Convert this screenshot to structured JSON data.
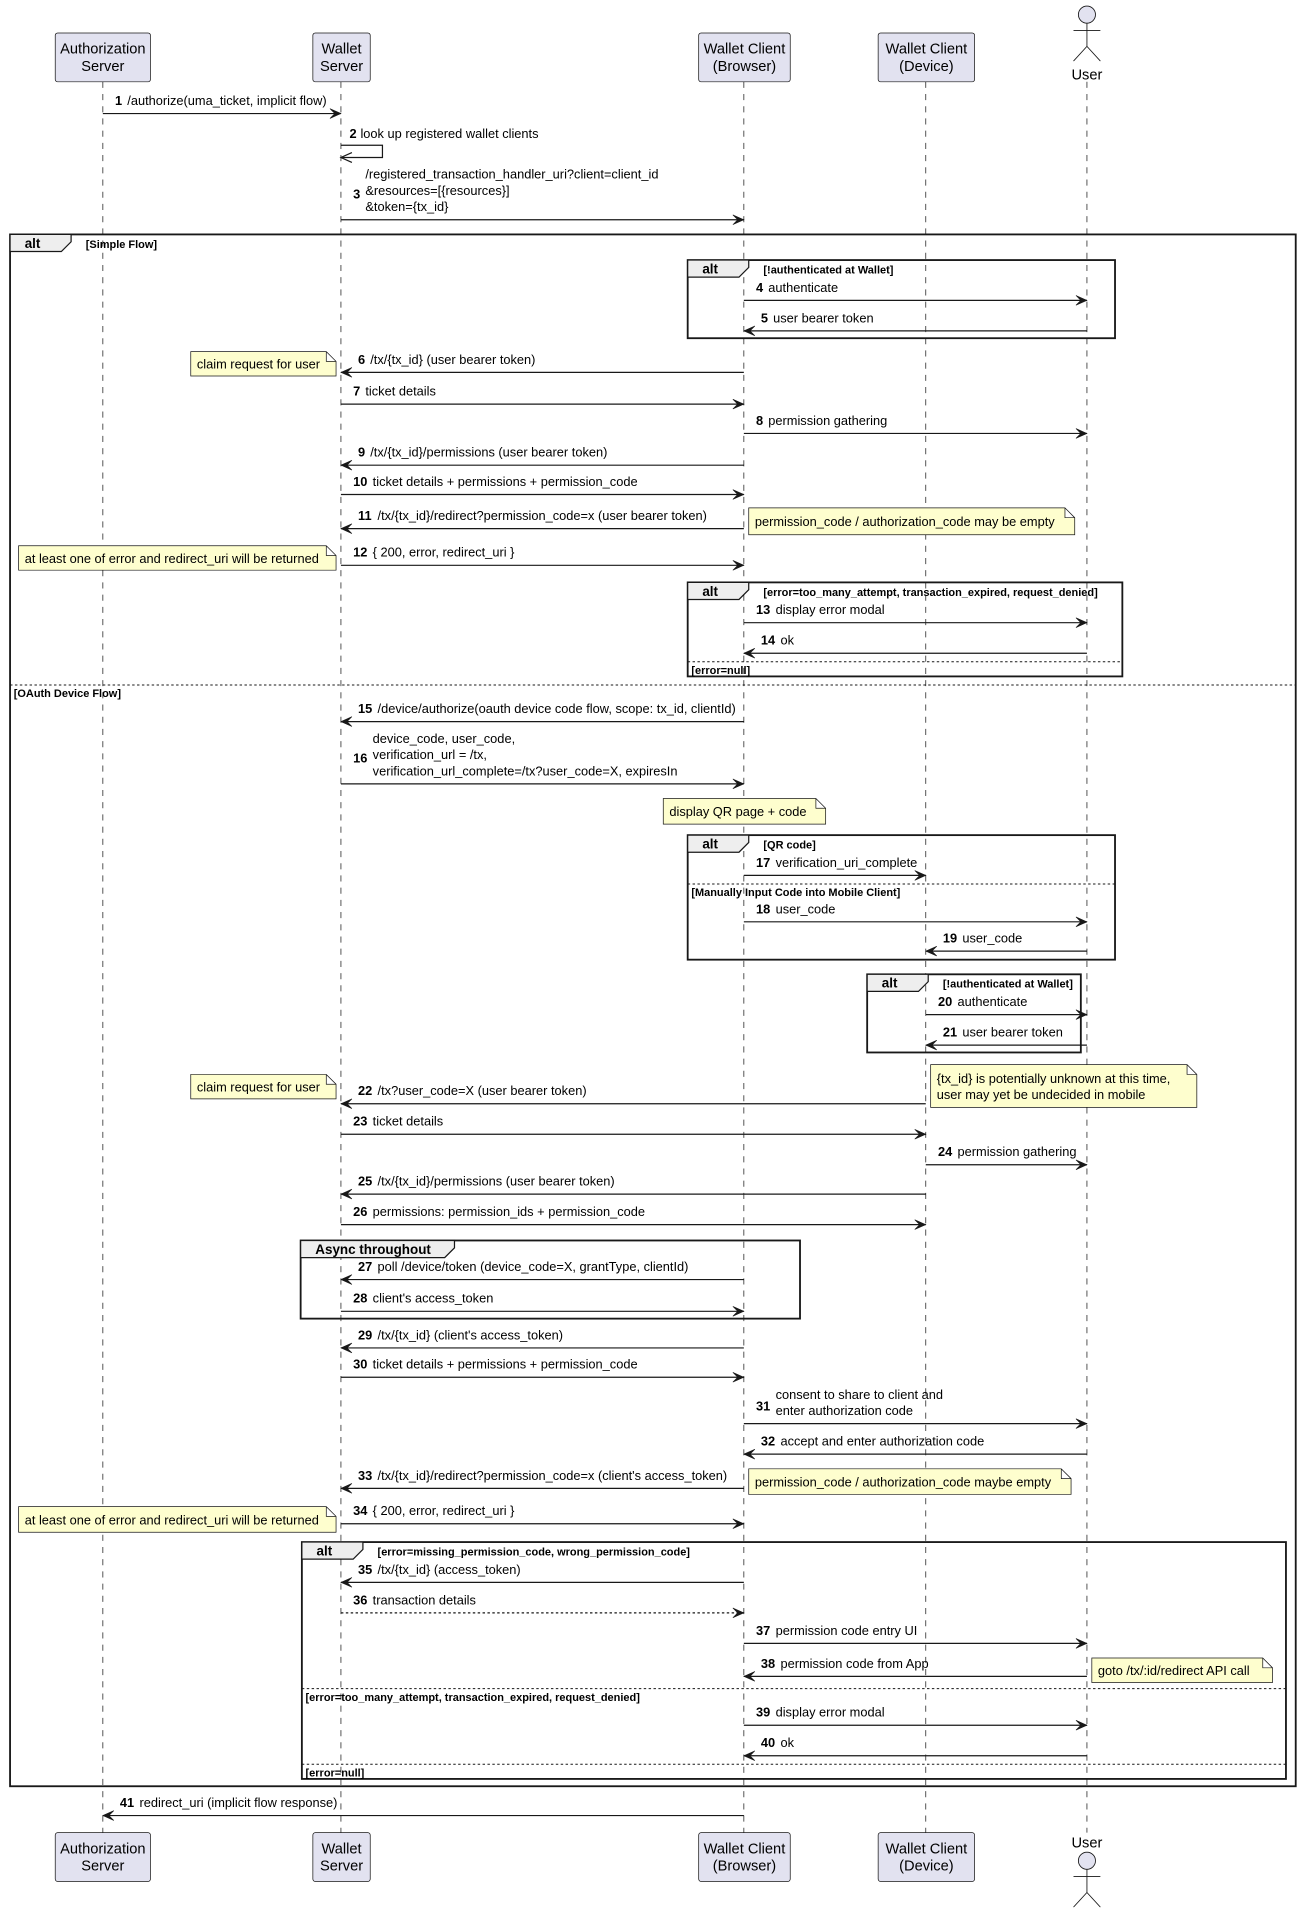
{
  "participants": [
    {
      "id": "as",
      "lines": [
        "Authorization",
        "Server"
      ],
      "kind": "box"
    },
    {
      "id": "ws",
      "lines": [
        "Wallet",
        "Server"
      ],
      "kind": "box"
    },
    {
      "id": "wcb",
      "lines": [
        "Wallet Client",
        "(Browser)"
      ],
      "kind": "box"
    },
    {
      "id": "wcd",
      "lines": [
        "Wallet Client",
        "(Device)"
      ],
      "kind": "box"
    },
    {
      "id": "user",
      "lines": [
        "User"
      ],
      "kind": "actor"
    }
  ],
  "colors": {
    "participant_fill": "#e2e2f0",
    "participant_border": "#181818",
    "note_fill": "#fefece",
    "frame_header": "#eeeeee",
    "line": "#181818"
  },
  "messages": [
    {
      "num": "1",
      "from": "as",
      "to": "ws",
      "lines": [
        "/authorize(uma_ticket, implicit flow)"
      ]
    },
    {
      "num": "2",
      "from": "ws",
      "to": "ws",
      "lines": [
        "look up registered wallet clients"
      ]
    },
    {
      "num": "3",
      "from": "ws",
      "to": "wcb",
      "lines": [
        "/registered_transaction_handler_uri?client=client_id",
        "&resources=[{resources}]",
        "&token={tx_id}"
      ]
    },
    {
      "num": "4",
      "from": "wcb",
      "to": "user",
      "lines": [
        "authenticate"
      ]
    },
    {
      "num": "5",
      "from": "user",
      "to": "wcb",
      "lines": [
        "user bearer token"
      ]
    },
    {
      "num": "6",
      "from": "wcb",
      "to": "ws",
      "lines": [
        "/tx/{tx_id} (user bearer token)"
      ]
    },
    {
      "num": "7",
      "from": "ws",
      "to": "wcb",
      "lines": [
        "ticket details"
      ]
    },
    {
      "num": "8",
      "from": "wcb",
      "to": "user",
      "lines": [
        "permission gathering"
      ]
    },
    {
      "num": "9",
      "from": "wcb",
      "to": "ws",
      "lines": [
        "/tx/{tx_id}/permissions (user bearer token)"
      ]
    },
    {
      "num": "10",
      "from": "ws",
      "to": "wcb",
      "lines": [
        "ticket details + permissions + permission_code"
      ]
    },
    {
      "num": "11",
      "from": "wcb",
      "to": "ws",
      "lines": [
        "/tx/{tx_id}/redirect?permission_code=x (user bearer token)"
      ]
    },
    {
      "num": "12",
      "from": "ws",
      "to": "wcb",
      "lines": [
        "{ 200, error, redirect_uri }"
      ]
    },
    {
      "num": "13",
      "from": "wcb",
      "to": "user",
      "lines": [
        "display error modal"
      ]
    },
    {
      "num": "14",
      "from": "user",
      "to": "wcb",
      "lines": [
        "ok"
      ]
    },
    {
      "num": "15",
      "from": "wcb",
      "to": "ws",
      "lines": [
        "/device/authorize(oauth device code flow, scope: tx_id, clientId)"
      ]
    },
    {
      "num": "16",
      "from": "ws",
      "to": "wcb",
      "lines": [
        "device_code, user_code,",
        "verification_url = /tx,",
        "verification_url_complete=/tx?user_code=X, expiresIn"
      ]
    },
    {
      "num": "17",
      "from": "wcb",
      "to": "wcd",
      "lines": [
        "verification_uri_complete"
      ]
    },
    {
      "num": "18",
      "from": "wcb",
      "to": "user",
      "lines": [
        "user_code"
      ]
    },
    {
      "num": "19",
      "from": "user",
      "to": "wcd",
      "lines": [
        "user_code"
      ]
    },
    {
      "num": "20",
      "from": "wcd",
      "to": "user",
      "lines": [
        "authenticate"
      ]
    },
    {
      "num": "21",
      "from": "user",
      "to": "wcd",
      "lines": [
        "user bearer token"
      ]
    },
    {
      "num": "22",
      "from": "wcd",
      "to": "ws",
      "lines": [
        "/tx?user_code=X (user bearer token)"
      ]
    },
    {
      "num": "23",
      "from": "ws",
      "to": "wcd",
      "lines": [
        "ticket details"
      ]
    },
    {
      "num": "24",
      "from": "wcd",
      "to": "user",
      "lines": [
        "permission gathering"
      ]
    },
    {
      "num": "25",
      "from": "wcd",
      "to": "ws",
      "lines": [
        "/tx/{tx_id}/permissions (user bearer token)"
      ]
    },
    {
      "num": "26",
      "from": "ws",
      "to": "wcd",
      "lines": [
        "permissions: permission_ids + permission_code"
      ]
    },
    {
      "num": "27",
      "from": "wcb",
      "to": "ws",
      "lines": [
        "poll /device/token (device_code=X, grantType, clientId)"
      ]
    },
    {
      "num": "28",
      "from": "ws",
      "to": "wcb",
      "lines": [
        "client's access_token"
      ]
    },
    {
      "num": "29",
      "from": "wcb",
      "to": "ws",
      "lines": [
        "/tx/{tx_id} (client's access_token)"
      ]
    },
    {
      "num": "30",
      "from": "ws",
      "to": "wcb",
      "lines": [
        "ticket details + permissions + permission_code"
      ]
    },
    {
      "num": "31",
      "from": "wcb",
      "to": "user",
      "lines": [
        "consent to share to client and",
        " enter authorization code"
      ]
    },
    {
      "num": "32",
      "from": "user",
      "to": "wcb",
      "lines": [
        "accept and enter authorization code"
      ]
    },
    {
      "num": "33",
      "from": "wcb",
      "to": "ws",
      "lines": [
        "/tx/{tx_id}/redirect?permission_code=x (client's access_token)"
      ]
    },
    {
      "num": "34",
      "from": "ws",
      "to": "wcb",
      "lines": [
        "{ 200, error, redirect_uri }"
      ]
    },
    {
      "num": "35",
      "from": "wcb",
      "to": "ws",
      "lines": [
        "/tx/{tx_id} (access_token)"
      ]
    },
    {
      "num": "36",
      "from": "ws",
      "to": "wcb",
      "lines": [
        "transaction details"
      ],
      "dashed": true
    },
    {
      "num": "37",
      "from": "wcb",
      "to": "user",
      "lines": [
        "permission code entry UI"
      ]
    },
    {
      "num": "38",
      "from": "user",
      "to": "wcb",
      "lines": [
        "permission code from App"
      ]
    },
    {
      "num": "39",
      "from": "wcb",
      "to": "user",
      "lines": [
        "display error modal"
      ]
    },
    {
      "num": "40",
      "from": "user",
      "to": "wcb",
      "lines": [
        "ok"
      ]
    },
    {
      "num": "41",
      "from": "wcb",
      "to": "as",
      "lines": [
        "redirect_uri (implicit flow response)"
      ]
    }
  ],
  "frames": [
    {
      "keyword": "alt",
      "guard": "[Simple Flow]",
      "sections": [
        "[OAuth Device Flow]"
      ]
    },
    {
      "keyword": "alt",
      "guard": "[!authenticated at Wallet]",
      "sections": []
    },
    {
      "keyword": "alt",
      "guard": "[error=too_many_attempt, transaction_expired, request_denied]",
      "sections": [
        "[error=null]"
      ]
    },
    {
      "keyword": "alt",
      "guard": "[QR code]",
      "sections": [
        "[Manually Input Code into Mobile Client]"
      ]
    },
    {
      "keyword": "alt",
      "guard": "[!authenticated at Wallet]",
      "sections": []
    },
    {
      "keyword": "Async throughout",
      "guard": "",
      "sections": []
    },
    {
      "keyword": "alt",
      "guard": "[error=missing_permission_code, wrong_permission_code]",
      "sections": [
        "[error=too_many_attempt, transaction_expired, request_denied]",
        "[error=null]"
      ]
    }
  ],
  "notes": [
    {
      "lines": [
        "claim request for user"
      ]
    },
    {
      "lines": [
        "permission_code / authorization_code may be empty"
      ]
    },
    {
      "lines": [
        "at least one of error and redirect_uri will be returned"
      ]
    },
    {
      "lines": [
        "display QR page + code"
      ]
    },
    {
      "lines": [
        "claim request for user"
      ]
    },
    {
      "lines": [
        "{tx_id} is potentially unknown at this time,",
        "user may yet be undecided in mobile"
      ]
    },
    {
      "lines": [
        "permission_code / authorization_code maybe empty"
      ]
    },
    {
      "lines": [
        "at least one of error and redirect_uri will be returned"
      ]
    },
    {
      "lines": [
        "goto /tx/:id/redirect API call"
      ]
    }
  ]
}
